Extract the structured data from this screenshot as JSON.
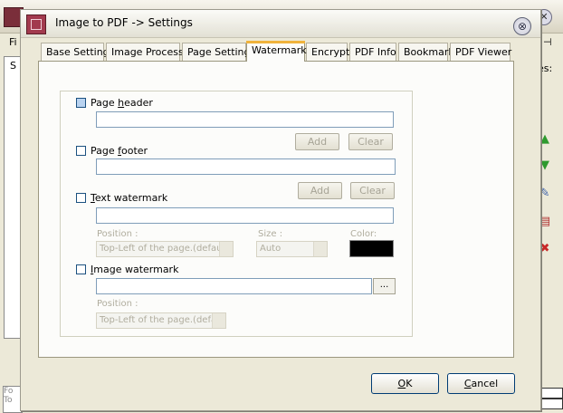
{
  "background_window": {
    "menu_fragment": "Fi",
    "panel_fragment": "S",
    "right_label_fragment": "es:",
    "bottom_fragment_1": "Fo",
    "bottom_fragment_2": "To"
  },
  "dialog": {
    "title": "Image to PDF -> Settings",
    "close_glyph": "⊗"
  },
  "tabs": [
    {
      "label": "Base Setting"
    },
    {
      "label": "Image Process"
    },
    {
      "label": "Page Setting"
    },
    {
      "label": "Watermark",
      "active": true
    },
    {
      "label": "Encrypt"
    },
    {
      "label": "PDF Info"
    },
    {
      "label": "Bookmark"
    },
    {
      "label": "PDF Viewer"
    }
  ],
  "watermark": {
    "page_header": {
      "label_pre": "Page ",
      "label_u": "h",
      "label_post": "eader",
      "checked": false,
      "value": ""
    },
    "page_footer": {
      "label_pre": "Page ",
      "label_u": "f",
      "label_post": "ooter",
      "checked": false,
      "value": ""
    },
    "header_add_label": "Add",
    "header_clear_label": "Clear",
    "footer_add_label": "Add",
    "footer_clear_label": "Clear",
    "text_watermark": {
      "label_pre": "",
      "label_u": "T",
      "label_post": "ext watermark",
      "checked": false,
      "value": ""
    },
    "text_position_label": "Position :",
    "text_position_value": "Top-Left of the page.(defau",
    "size_label": "Size :",
    "size_value": "Auto",
    "color_label": "Color:",
    "color_value": "#000000",
    "image_watermark": {
      "label_pre": "",
      "label_u": "I",
      "label_post": "mage watermark",
      "checked": false,
      "value": ""
    },
    "browse_label": "...",
    "image_position_label": "Position :",
    "image_position_value": "Top-Left of the page.(defa"
  },
  "footer": {
    "ok_u": "O",
    "ok_rest": "K",
    "cancel_u": "C",
    "cancel_rest": "ancel"
  }
}
